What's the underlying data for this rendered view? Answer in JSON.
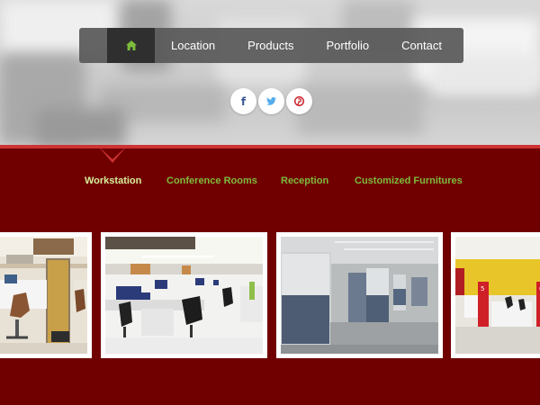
{
  "nav": {
    "home_icon": "home-icon",
    "items": [
      {
        "label": "Location"
      },
      {
        "label": "Products"
      },
      {
        "label": "Portfolio"
      },
      {
        "label": "Contact"
      }
    ]
  },
  "social": [
    {
      "name": "facebook-icon",
      "glyph": "f",
      "color": "#3b5998"
    },
    {
      "name": "twitter-icon",
      "color": "#55acee"
    },
    {
      "name": "pinterest-icon",
      "color": "#cb2027"
    }
  ],
  "tabs": [
    {
      "label": "Workstation",
      "active": true
    },
    {
      "label": "Conference Rooms",
      "active": false
    },
    {
      "label": "Reception",
      "active": false
    },
    {
      "label": "Customized Furnitures",
      "active": false
    }
  ],
  "colors": {
    "background": "#700000",
    "accent_line": "#cc3333",
    "tab_active": "#d6ef9b",
    "tab_inactive": "#7dbb3c",
    "nav_bg": "#585858",
    "nav_home_bg": "#2f2f2f"
  },
  "gallery": [
    {
      "subject": "workstation-photo"
    },
    {
      "subject": "open-office-photo"
    },
    {
      "subject": "partition-office-photo"
    },
    {
      "subject": "reception-photo"
    }
  ]
}
